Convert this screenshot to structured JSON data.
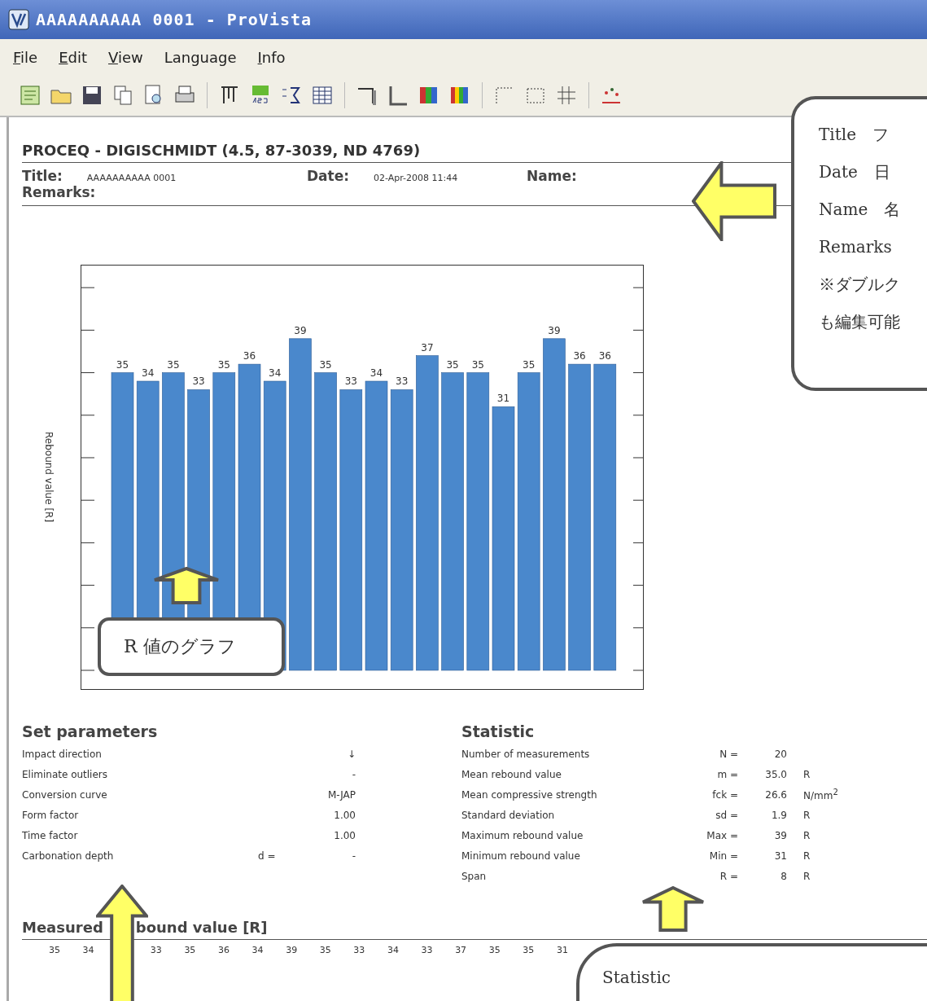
{
  "window": {
    "title": "AAAAAAAAAA 0001 - ProVista"
  },
  "menu": [
    {
      "label": "File",
      "accel": true
    },
    {
      "label": "Edit",
      "accel": true
    },
    {
      "label": "View",
      "accel": true
    },
    {
      "label": "Language",
      "accel": false
    },
    {
      "label": "Info",
      "accel": true
    }
  ],
  "report": {
    "heading": "PROCEQ - DIGISCHMIDT (4.5, 87-3039, ND 4769)",
    "fields": [
      {
        "label": "Title:",
        "value": "AAAAAAAAAA 0001"
      },
      {
        "label": "Date:",
        "value": "02-Apr-2008 11:44"
      },
      {
        "label": "Name:"
      }
    ],
    "remarks_label": "Remarks:",
    "chart": {
      "chart_data": {
        "type": "bar",
        "ylabel": "Rebound value [R]",
        "data_labels": true,
        "series": [
          {
            "color": "#4a88cc",
            "values": [
              35,
              34,
              35,
              33,
              35,
              36,
              34,
              39,
              35,
              33,
              34,
              33,
              37,
              35,
              35,
              31,
              35,
              39,
              36,
              36
            ]
          }
        ]
      }
    },
    "parameters": {
      "title": "Set parameters",
      "rows": [
        {
          "label": "Impact direction",
          "value": "↓"
        },
        {
          "label": "Eliminate outliers",
          "value": "-"
        },
        {
          "label": "Conversion curve",
          "value": "M-JAP"
        },
        {
          "label": "Form factor",
          "value": "1.00"
        },
        {
          "label": "Time factor",
          "value": "1.00"
        },
        {
          "label": "Carbonation depth",
          "symbol": "d =",
          "value": "-"
        }
      ]
    },
    "statistic": {
      "title": "Statistic",
      "rows": [
        {
          "label": "Number of measurements",
          "symbol": "N =",
          "value": "20"
        },
        {
          "label": "Mean rebound value",
          "symbol": "m =",
          "value": "35.0",
          "unit": "R"
        },
        {
          "label": "Mean compressive strength",
          "symbol": "fck =",
          "value": "26.6",
          "unit": "N/mm$^{2}$"
        },
        {
          "label": "Standard deviation",
          "symbol": "sd =",
          "value": "1.9",
          "unit": "R"
        },
        {
          "label": "Maximum rebound value",
          "symbol": "Max =",
          "value": "39",
          "unit": "R"
        },
        {
          "label": "Minimum rebound value",
          "symbol": "Min =",
          "value": "31",
          "unit": "R"
        },
        {
          "label": "Span",
          "symbol": "R =",
          "value": "8",
          "unit": "R"
        }
      ]
    },
    "measured": {
      "title_left": "Measured",
      "title_right": "bound value [R]",
      "values_before_arrow": [
        "35",
        "34"
      ],
      "values_after_arrow": [
        "33",
        "35",
        "36",
        "34",
        "39",
        "35",
        "33",
        "34",
        "33",
        "37",
        "35",
        "35",
        "31"
      ]
    }
  },
  "callouts": {
    "fields": {
      "lines": [
        "Title　フ",
        "Date　日",
        "Name　名",
        "Remarks",
        "※ダブルク",
        "も編集可能"
      ]
    },
    "chart": {
      "text": "R 値のグラフ"
    },
    "statistic": {
      "text": "Statistic"
    }
  }
}
